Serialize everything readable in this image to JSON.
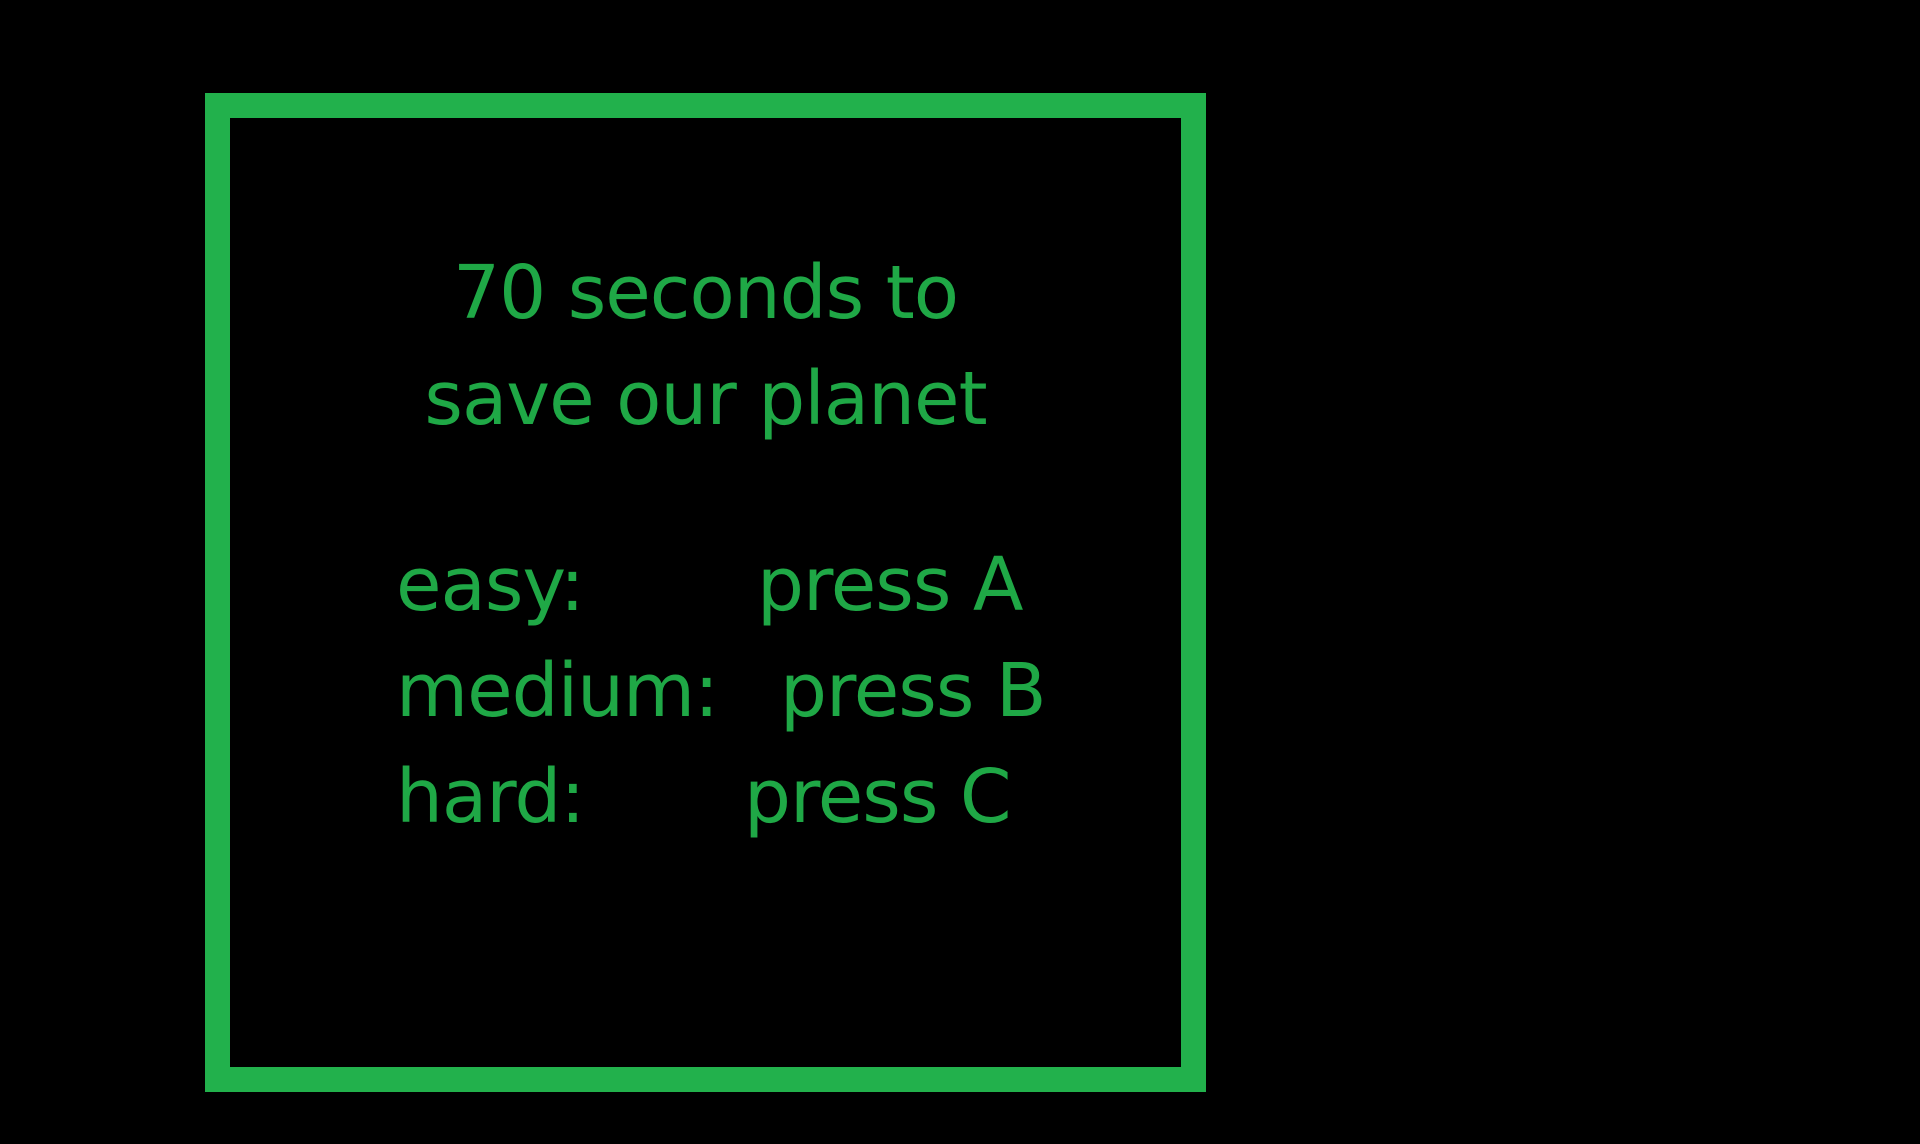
{
  "title": {
    "line1": "70 seconds to",
    "line2": "save our planet"
  },
  "difficulty_options": [
    {
      "label": "easy:",
      "action": "press A"
    },
    {
      "label": "medium:",
      "action": "press B"
    },
    {
      "label": "hard:",
      "action": "press C"
    }
  ],
  "colors": {
    "background": "#000000",
    "frame": "#22b14c",
    "text": "#1fa846"
  }
}
